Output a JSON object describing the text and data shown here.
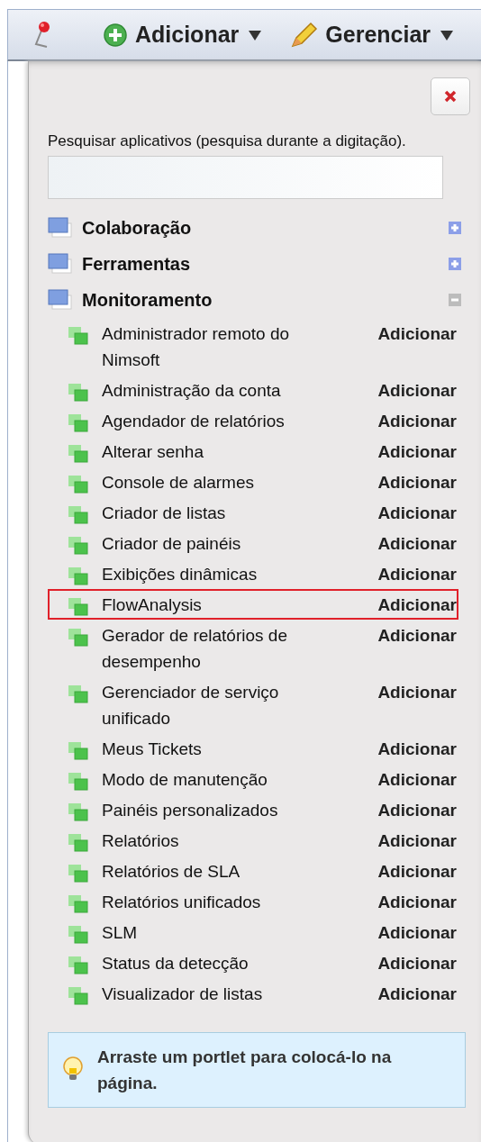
{
  "toolbar": [
    {
      "kind": "pin"
    },
    {
      "kind": "add",
      "label": "Adicionar"
    },
    {
      "kind": "edit",
      "label": "Gerenciar"
    }
  ],
  "search": {
    "label": "Pesquisar aplicativos (pesquisa durante a digitação)."
  },
  "categories": [
    {
      "name": "Colaboração",
      "expanded": false
    },
    {
      "name": "Ferramentas",
      "expanded": false
    },
    {
      "name": "Monitoramento",
      "expanded": true,
      "children": [
        {
          "name": "Administrador remoto do Nimsoft",
          "action": "Adicionar",
          "highlighted": false
        },
        {
          "name": "Administração da conta",
          "action": "Adicionar",
          "highlighted": false
        },
        {
          "name": "Agendador de relatórios",
          "action": "Adicionar",
          "highlighted": false
        },
        {
          "name": "Alterar senha",
          "action": "Adicionar",
          "highlighted": false
        },
        {
          "name": "Console de alarmes",
          "action": "Adicionar",
          "highlighted": false
        },
        {
          "name": "Criador de listas",
          "action": "Adicionar",
          "highlighted": false
        },
        {
          "name": "Criador de painéis",
          "action": "Adicionar",
          "highlighted": false
        },
        {
          "name": "Exibições dinâmicas",
          "action": "Adicionar",
          "highlighted": false
        },
        {
          "name": "FlowAnalysis",
          "action": "Adicionar",
          "highlighted": true
        },
        {
          "name": "Gerador de relatórios de desempenho",
          "action": "Adicionar",
          "highlighted": false
        },
        {
          "name": "Gerenciador de serviço unificado",
          "action": "Adicionar",
          "highlighted": false
        },
        {
          "name": "Meus Tickets",
          "action": "Adicionar",
          "highlighted": false
        },
        {
          "name": "Modo de manutenção",
          "action": "Adicionar",
          "highlighted": false
        },
        {
          "name": "Painéis personalizados",
          "action": "Adicionar",
          "highlighted": false
        },
        {
          "name": "Relatórios",
          "action": "Adicionar",
          "highlighted": false
        },
        {
          "name": "Relatórios de SLA",
          "action": "Adicionar",
          "highlighted": false
        },
        {
          "name": "Relatórios unificados",
          "action": "Adicionar",
          "highlighted": false
        },
        {
          "name": "SLM",
          "action": "Adicionar",
          "highlighted": false
        },
        {
          "name": "Status da detecção",
          "action": "Adicionar",
          "highlighted": false
        },
        {
          "name": "Visualizador de listas",
          "action": "Adicionar",
          "highlighted": false
        }
      ]
    }
  ],
  "tip": "Arraste um portlet para colocá-lo na página."
}
